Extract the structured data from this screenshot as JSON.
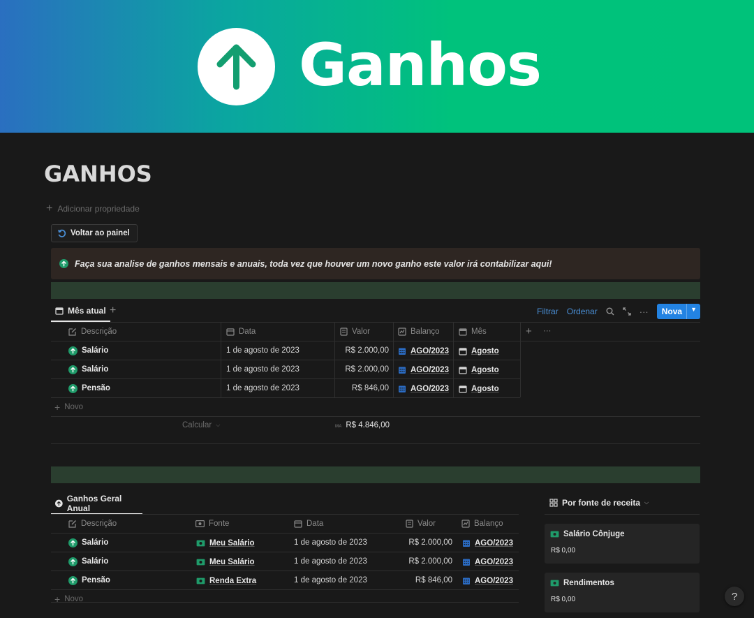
{
  "banner": {
    "title": "Ganhos"
  },
  "page": {
    "title": "GANHOS",
    "add_property": "Adicionar propriedade",
    "back_button": "Voltar ao painel"
  },
  "callout": {
    "text": "Faça sua analise de ganhos mensais e anuais, toda vez que houver um novo ganho este valor irá contabilizar aqui!"
  },
  "monthly": {
    "tab": "Mês atual",
    "toolbar": {
      "filter": "Filtrar",
      "sort": "Ordenar",
      "new": "Nova"
    },
    "columns": {
      "description": "Descrição",
      "date": "Data",
      "value": "Valor",
      "balance": "Balanço",
      "month": "Mês"
    },
    "rows": [
      {
        "description": "Salário",
        "date": "1 de agosto de 2023",
        "value": "R$ 2.000,00",
        "balance": "AGO/2023",
        "month": "Agosto"
      },
      {
        "description": "Salário",
        "date": "1 de agosto de 2023",
        "value": "R$ 2.000,00",
        "balance": "AGO/2023",
        "month": "Agosto"
      },
      {
        "description": "Pensão",
        "date": "1 de agosto de 2023",
        "value": "R$ 846,00",
        "balance": "AGO/2023",
        "month": "Agosto"
      }
    ],
    "new_row": "Novo",
    "calculate": "Calcular",
    "sum_label": "ᴍᴀ",
    "sum_value": "R$ 4.846,00"
  },
  "annual": {
    "tab": "Ganhos Geral Anual",
    "columns": {
      "description": "Descrição",
      "source": "Fonte",
      "date": "Data",
      "value": "Valor",
      "balance": "Balanço"
    },
    "rows": [
      {
        "description": "Salário",
        "source": "Meu Salário",
        "date": "1 de agosto de 2023",
        "value": "R$ 2.000,00",
        "balance": "AGO/2023"
      },
      {
        "description": "Salário",
        "source": "Meu Salário",
        "date": "1 de agosto de 2023",
        "value": "R$ 2.000,00",
        "balance": "AGO/2023"
      },
      {
        "description": "Pensão",
        "source": "Renda Extra",
        "date": "1 de agosto de 2023",
        "value": "R$ 846,00",
        "balance": "AGO/2023"
      }
    ],
    "new_row": "Novo"
  },
  "gallery": {
    "title": "Por fonte de receita",
    "cards": [
      {
        "title": "Salário Cônjuge",
        "value": "R$ 0,00"
      },
      {
        "title": "Rendimentos",
        "value": "R$ 0,00"
      }
    ]
  },
  "help": "?",
  "colors": {
    "accent": "#2383e2",
    "up_icon": "#1f9b6a",
    "banner_from": "#2a6fc0",
    "banner_to": "#00c27a"
  }
}
